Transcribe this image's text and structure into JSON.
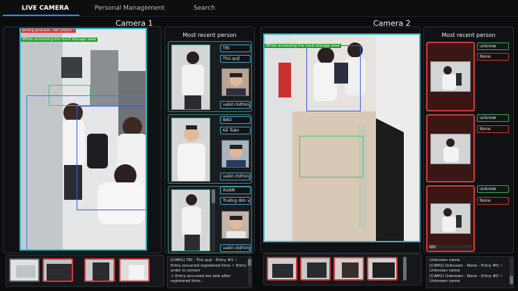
{
  "nav": {
    "tabs": [
      {
        "label": "LIVE CAMERA",
        "active": true
      },
      {
        "label": "Personal Management",
        "active": false
      },
      {
        "label": "Search",
        "active": false
      }
    ]
  },
  "camera1": {
    "title": "Camera 1",
    "overlay_warning": "wrong process, not attack !",
    "overlay_info": "While accessing the fund storage area",
    "recent_title": "Most recent person",
    "people": [
      {
        "name": "TRI",
        "role": "Thủ quỹ",
        "clothing": "valid clothing"
      },
      {
        "name": "BAO",
        "role": "Kế Toán",
        "clothing": "valid clothing"
      },
      {
        "name": "XUAN",
        "role": "Trưởng đơn vị",
        "clothing": "valid clothing"
      }
    ],
    "log": {
      "line1_prefix": "[CAM1] TRI - Thủ quỹ - Entry #3",
      "line1_mid": "Entry occurred  registered time",
      "line1_end": "Entry order is correct",
      "line2": "Entry occurred too late after registered time..."
    }
  },
  "camera2": {
    "title": "Camera 2",
    "overlay_info": "While accessing the fund storage area",
    "recent_title": "Most recent person",
    "people": [
      {
        "name": "unknow",
        "role": "None"
      },
      {
        "name": "unknow",
        "role": "None"
      },
      {
        "name": "unknow",
        "role": "None"
      }
    ],
    "log": {
      "line1": "Unknown name",
      "line2": "[CAM2] Unknown - None - Entry #0",
      "line3": "Unknown name",
      "line4": "[CAM2] Unknown - None - Entry #0",
      "line5": "Unknown name"
    }
  },
  "colors": {
    "accent": "#2d8cff",
    "feed_border": "#3ab8c8",
    "alert_red": "#d23a3a",
    "ok_green": "#3ac86a"
  }
}
